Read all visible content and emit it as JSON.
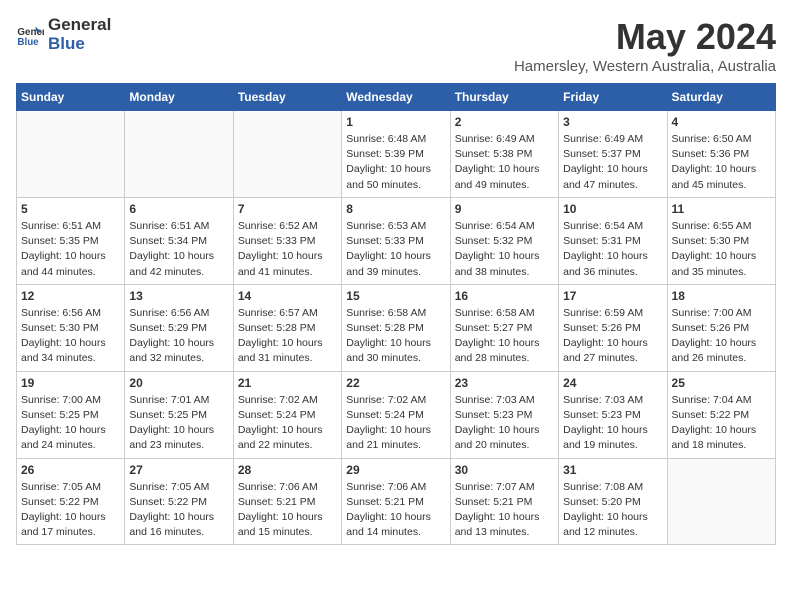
{
  "logo": {
    "text_general": "General",
    "text_blue": "Blue"
  },
  "title": {
    "month_year": "May 2024",
    "location": "Hamersley, Western Australia, Australia"
  },
  "weekdays": [
    "Sunday",
    "Monday",
    "Tuesday",
    "Wednesday",
    "Thursday",
    "Friday",
    "Saturday"
  ],
  "weeks": [
    [
      {
        "num": "",
        "info": ""
      },
      {
        "num": "",
        "info": ""
      },
      {
        "num": "",
        "info": ""
      },
      {
        "num": "1",
        "info": "Sunrise: 6:48 AM\nSunset: 5:39 PM\nDaylight: 10 hours\nand 50 minutes."
      },
      {
        "num": "2",
        "info": "Sunrise: 6:49 AM\nSunset: 5:38 PM\nDaylight: 10 hours\nand 49 minutes."
      },
      {
        "num": "3",
        "info": "Sunrise: 6:49 AM\nSunset: 5:37 PM\nDaylight: 10 hours\nand 47 minutes."
      },
      {
        "num": "4",
        "info": "Sunrise: 6:50 AM\nSunset: 5:36 PM\nDaylight: 10 hours\nand 45 minutes."
      }
    ],
    [
      {
        "num": "5",
        "info": "Sunrise: 6:51 AM\nSunset: 5:35 PM\nDaylight: 10 hours\nand 44 minutes."
      },
      {
        "num": "6",
        "info": "Sunrise: 6:51 AM\nSunset: 5:34 PM\nDaylight: 10 hours\nand 42 minutes."
      },
      {
        "num": "7",
        "info": "Sunrise: 6:52 AM\nSunset: 5:33 PM\nDaylight: 10 hours\nand 41 minutes."
      },
      {
        "num": "8",
        "info": "Sunrise: 6:53 AM\nSunset: 5:33 PM\nDaylight: 10 hours\nand 39 minutes."
      },
      {
        "num": "9",
        "info": "Sunrise: 6:54 AM\nSunset: 5:32 PM\nDaylight: 10 hours\nand 38 minutes."
      },
      {
        "num": "10",
        "info": "Sunrise: 6:54 AM\nSunset: 5:31 PM\nDaylight: 10 hours\nand 36 minutes."
      },
      {
        "num": "11",
        "info": "Sunrise: 6:55 AM\nSunset: 5:30 PM\nDaylight: 10 hours\nand 35 minutes."
      }
    ],
    [
      {
        "num": "12",
        "info": "Sunrise: 6:56 AM\nSunset: 5:30 PM\nDaylight: 10 hours\nand 34 minutes."
      },
      {
        "num": "13",
        "info": "Sunrise: 6:56 AM\nSunset: 5:29 PM\nDaylight: 10 hours\nand 32 minutes."
      },
      {
        "num": "14",
        "info": "Sunrise: 6:57 AM\nSunset: 5:28 PM\nDaylight: 10 hours\nand 31 minutes."
      },
      {
        "num": "15",
        "info": "Sunrise: 6:58 AM\nSunset: 5:28 PM\nDaylight: 10 hours\nand 30 minutes."
      },
      {
        "num": "16",
        "info": "Sunrise: 6:58 AM\nSunset: 5:27 PM\nDaylight: 10 hours\nand 28 minutes."
      },
      {
        "num": "17",
        "info": "Sunrise: 6:59 AM\nSunset: 5:26 PM\nDaylight: 10 hours\nand 27 minutes."
      },
      {
        "num": "18",
        "info": "Sunrise: 7:00 AM\nSunset: 5:26 PM\nDaylight: 10 hours\nand 26 minutes."
      }
    ],
    [
      {
        "num": "19",
        "info": "Sunrise: 7:00 AM\nSunset: 5:25 PM\nDaylight: 10 hours\nand 24 minutes."
      },
      {
        "num": "20",
        "info": "Sunrise: 7:01 AM\nSunset: 5:25 PM\nDaylight: 10 hours\nand 23 minutes."
      },
      {
        "num": "21",
        "info": "Sunrise: 7:02 AM\nSunset: 5:24 PM\nDaylight: 10 hours\nand 22 minutes."
      },
      {
        "num": "22",
        "info": "Sunrise: 7:02 AM\nSunset: 5:24 PM\nDaylight: 10 hours\nand 21 minutes."
      },
      {
        "num": "23",
        "info": "Sunrise: 7:03 AM\nSunset: 5:23 PM\nDaylight: 10 hours\nand 20 minutes."
      },
      {
        "num": "24",
        "info": "Sunrise: 7:03 AM\nSunset: 5:23 PM\nDaylight: 10 hours\nand 19 minutes."
      },
      {
        "num": "25",
        "info": "Sunrise: 7:04 AM\nSunset: 5:22 PM\nDaylight: 10 hours\nand 18 minutes."
      }
    ],
    [
      {
        "num": "26",
        "info": "Sunrise: 7:05 AM\nSunset: 5:22 PM\nDaylight: 10 hours\nand 17 minutes."
      },
      {
        "num": "27",
        "info": "Sunrise: 7:05 AM\nSunset: 5:22 PM\nDaylight: 10 hours\nand 16 minutes."
      },
      {
        "num": "28",
        "info": "Sunrise: 7:06 AM\nSunset: 5:21 PM\nDaylight: 10 hours\nand 15 minutes."
      },
      {
        "num": "29",
        "info": "Sunrise: 7:06 AM\nSunset: 5:21 PM\nDaylight: 10 hours\nand 14 minutes."
      },
      {
        "num": "30",
        "info": "Sunrise: 7:07 AM\nSunset: 5:21 PM\nDaylight: 10 hours\nand 13 minutes."
      },
      {
        "num": "31",
        "info": "Sunrise: 7:08 AM\nSunset: 5:20 PM\nDaylight: 10 hours\nand 12 minutes."
      },
      {
        "num": "",
        "info": ""
      }
    ]
  ]
}
